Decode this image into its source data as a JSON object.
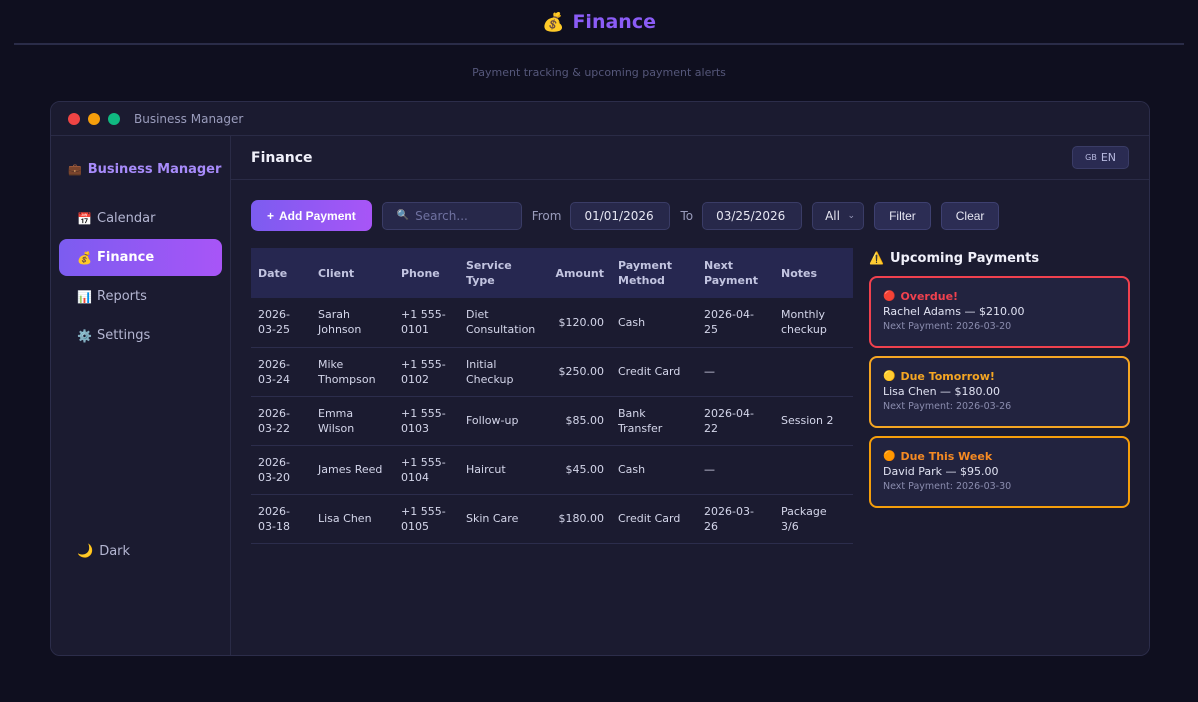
{
  "page": {
    "icon": "💰",
    "title": "Finance",
    "subtitle": "Payment tracking & upcoming payment alerts"
  },
  "window": {
    "title": "Business Manager"
  },
  "sidebar": {
    "brand_icon": "💼",
    "brand": "Business Manager",
    "items": [
      {
        "icon": "📅",
        "label": "Calendar",
        "active": false
      },
      {
        "icon": "💰",
        "label": "Finance",
        "active": true
      },
      {
        "icon": "📊",
        "label": "Reports",
        "active": false
      },
      {
        "icon": "⚙️",
        "label": "Settings",
        "active": false
      }
    ],
    "theme_icon": "🌙",
    "theme_label": "Dark"
  },
  "header": {
    "title": "Finance",
    "lang_flag": "GB",
    "lang_label": "EN"
  },
  "toolbar": {
    "add_icon": "+",
    "add_label": "Add Payment",
    "search_icon": "🔍",
    "search_placeholder": "Search...",
    "from_label": "From",
    "from_value": "01/01/2026",
    "to_label": "To",
    "to_value": "03/25/2026",
    "select_value": "All",
    "filter_label": "Filter",
    "clear_label": "Clear"
  },
  "table": {
    "headers": [
      "Date",
      "Client",
      "Phone",
      "Service Type",
      "Amount",
      "Payment Method",
      "Next Payment",
      "Notes"
    ],
    "rows": [
      [
        "2026-03-25",
        "Sarah Johnson",
        "+1 555-0101",
        "Diet Consultation",
        "$120.00",
        "Cash",
        "2026-04-25",
        "Monthly checkup"
      ],
      [
        "2026-03-24",
        "Mike Thompson",
        "+1 555-0102",
        "Initial Checkup",
        "$250.00",
        "Credit Card",
        "—",
        ""
      ],
      [
        "2026-03-22",
        "Emma Wilson",
        "+1 555-0103",
        "Follow-up",
        "$85.00",
        "Bank Transfer",
        "2026-04-22",
        "Session 2"
      ],
      [
        "2026-03-20",
        "James Reed",
        "+1 555-0104",
        "Haircut",
        "$45.00",
        "Cash",
        "—",
        ""
      ],
      [
        "2026-03-18",
        "Lisa Chen",
        "+1 555-0105",
        "Skin Care",
        "$180.00",
        "Credit Card",
        "2026-03-26",
        "Package 3/6"
      ]
    ]
  },
  "upcoming": {
    "icon": "⚠️",
    "title": "Upcoming Payments",
    "cards": [
      {
        "status_icon": "🔴",
        "status": "Overdue!",
        "line": "Rachel Adams — $210.00",
        "next": "Next Payment: 2026-03-20",
        "color": "#f0414e"
      },
      {
        "status_icon": "🟡",
        "status": "Due Tomorrow!",
        "line": "Lisa Chen — $180.00",
        "next": "Next Payment: 2026-03-26",
        "color": "#f5a623"
      },
      {
        "status_icon": "🟠",
        "status": "Due This Week",
        "line": "David Park — $95.00",
        "next": "Next Payment: 2026-03-30",
        "color": "#f59e0b"
      }
    ]
  }
}
